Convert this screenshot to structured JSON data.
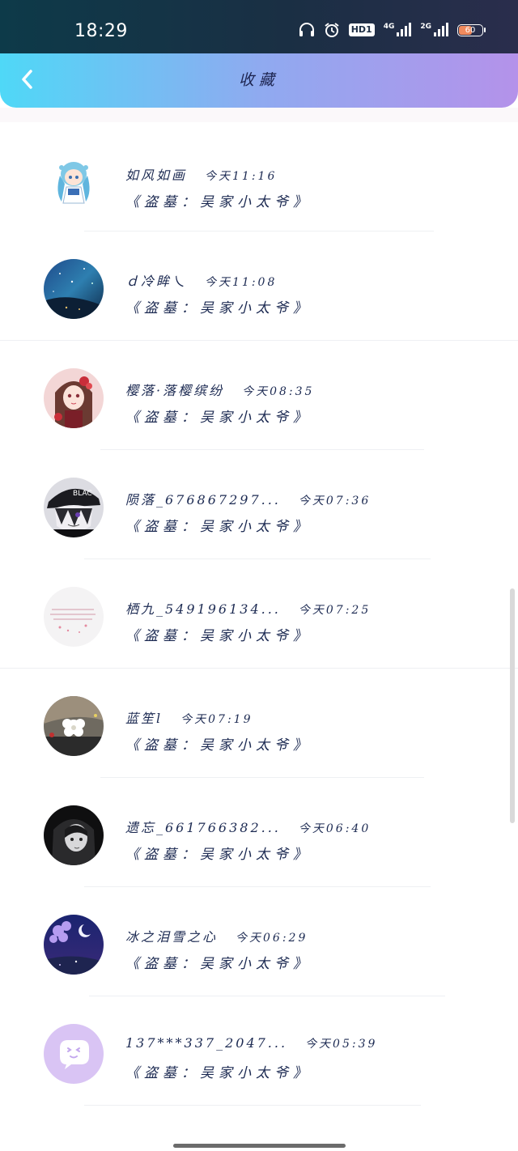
{
  "status_bar": {
    "time": "18:29",
    "icons": [
      "headphones-icon",
      "alarm-icon",
      "hd-icon",
      "signal-4g-icon",
      "signal-2g-icon",
      "battery-icon"
    ],
    "hd_label": "HD1",
    "net1_label": "4G",
    "net2_label": "2G",
    "battery_level": "60",
    "battery_fraction": 0.6
  },
  "header": {
    "title": "收藏",
    "back_icon": "chevron-left-icon",
    "colors": {
      "from": "#4fd8f7",
      "to": "#b492ea"
    }
  },
  "items": [
    {
      "name": "如风如画",
      "time": "今天11:16",
      "content": "《盗墓：吴家小太爷》",
      "avatar": "anime-girl-blue-hair"
    },
    {
      "name": "ｄ冷眸乀",
      "time": "今天11:08",
      "content": "《盗墓：吴家小太爷》",
      "avatar": "starry-night-blue"
    },
    {
      "name": "樱落·落樱缤纷",
      "time": "今天08:35",
      "content": "《盗墓：吴家小太爷》",
      "avatar": "anime-girl-red-flowers"
    },
    {
      "name": "陨落_676867297...",
      "time": "今天07:36",
      "content": "《盗墓：吴家小太爷》",
      "avatar": "anime-boy-black-cap"
    },
    {
      "name": "栖九_549196134...",
      "time": "今天07:25",
      "content": "《盗墓：吴家小太爷》",
      "avatar": "handwritten-text-pink"
    },
    {
      "name": "蓝笙l",
      "time": "今天07:19",
      "content": "《盗墓：吴家小太爷》",
      "avatar": "white-flower-night"
    },
    {
      "name": "遗忘_661766382...",
      "time": "今天06:40",
      "content": "《盗墓：吴家小太爷》",
      "avatar": "anime-girl-monochrome"
    },
    {
      "name": "冰之泪雪之心",
      "time": "今天06:29",
      "content": "《盗墓：吴家小太爷》",
      "avatar": "purple-blossom-night"
    },
    {
      "name": "137***337_2047...",
      "time": "今天05:39",
      "content": "《盗墓：吴家小太爷》",
      "avatar": "default-chat-purple"
    }
  ]
}
